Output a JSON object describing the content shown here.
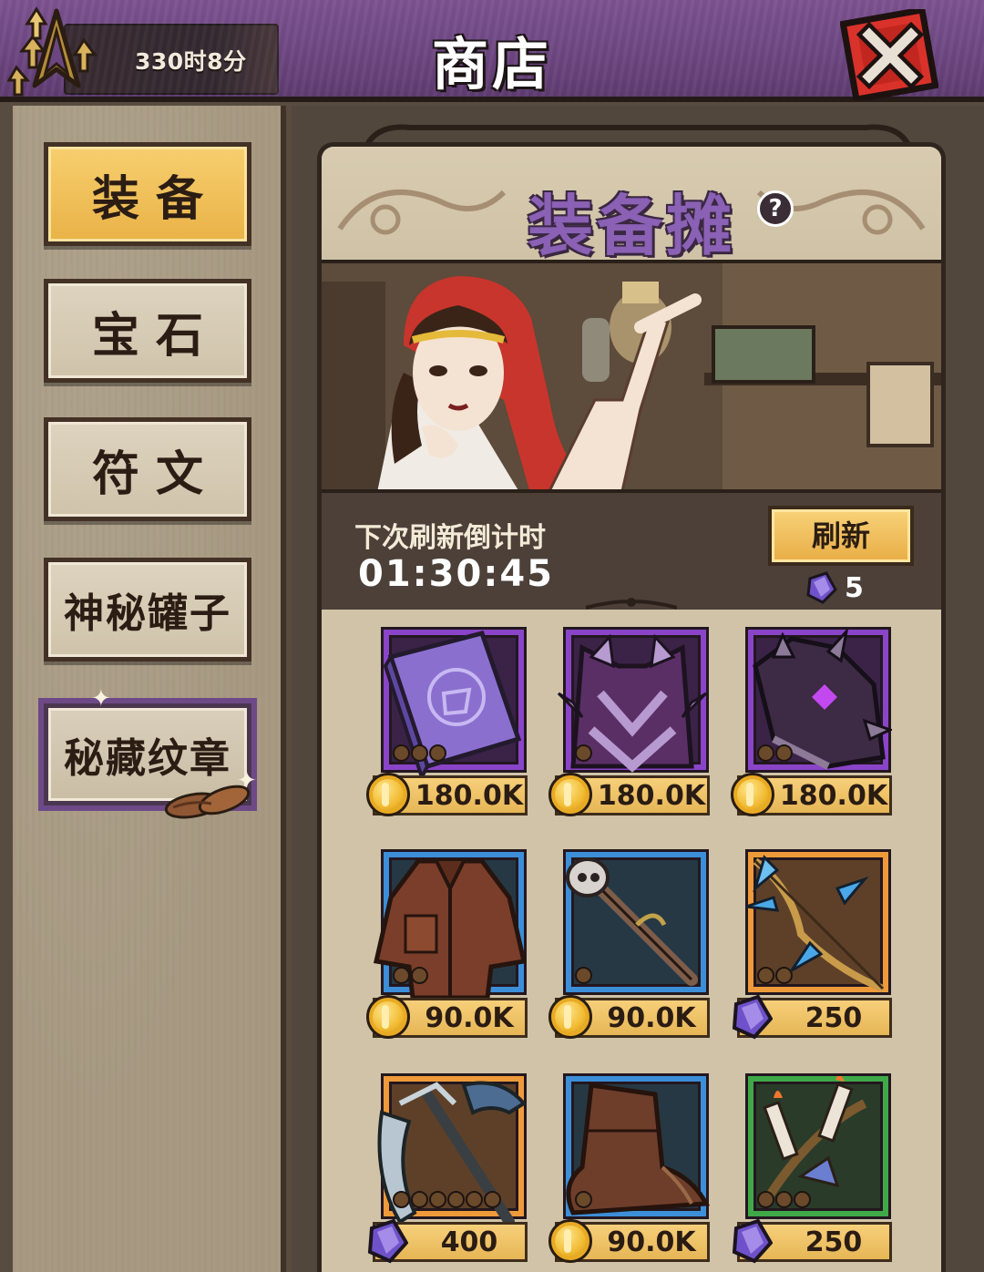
{
  "header": {
    "timer": "330时8分",
    "title": "商店"
  },
  "sidebar": {
    "tabs": [
      {
        "label": "装备",
        "active": true
      },
      {
        "label": "宝石",
        "active": false
      },
      {
        "label": "符文",
        "active": false
      },
      {
        "label": "神秘罐子",
        "active": false
      },
      {
        "label": "秘藏纹章",
        "active": false
      }
    ]
  },
  "shop": {
    "title": "装备摊",
    "help": "?",
    "refresh_label": "下次刷新倒计时",
    "refresh_time": "01:30:45",
    "refresh_button": "刷新",
    "refresh_cost": "5"
  },
  "items": [
    {
      "name": "purple-spellbook",
      "rarity": "epic",
      "price": "180.0K",
      "currency": "gold-coin",
      "stars": 3
    },
    {
      "name": "spiked-purple-armor",
      "rarity": "epic",
      "price": "180.0K",
      "currency": "gold-coin",
      "stars": 1
    },
    {
      "name": "dark-spiked-gauntlet",
      "rarity": "epic",
      "price": "180.0K",
      "currency": "gold-coin",
      "stars": 2
    },
    {
      "name": "brown-leather-coat",
      "rarity": "rare",
      "price": "90.0K",
      "currency": "gold-coin",
      "stars": 2
    },
    {
      "name": "skull-staff",
      "rarity": "rare",
      "price": "90.0K",
      "currency": "gold-coin",
      "stars": 1
    },
    {
      "name": "crystal-bow",
      "rarity": "legend",
      "price": "250",
      "currency": "purple-gem",
      "stars": 2
    },
    {
      "name": "dragon-scythe",
      "rarity": "legend",
      "price": "400",
      "currency": "purple-gem",
      "stars": 6
    },
    {
      "name": "leather-boots",
      "rarity": "rare",
      "price": "90.0K",
      "currency": "gold-coin",
      "stars": 1
    },
    {
      "name": "candle-ornament",
      "rarity": "green",
      "price": "250",
      "currency": "purple-gem",
      "stars": 3
    }
  ],
  "colors": {
    "header_purple": "#6c4680",
    "active_tab_gold": "#f2c160",
    "title_purple": "#8a61b4",
    "epic_purple": "#8a44c8",
    "rare_blue": "#3c8ed8",
    "legend_orange": "#ee9a3a",
    "uncommon_green": "#3fa94a"
  }
}
